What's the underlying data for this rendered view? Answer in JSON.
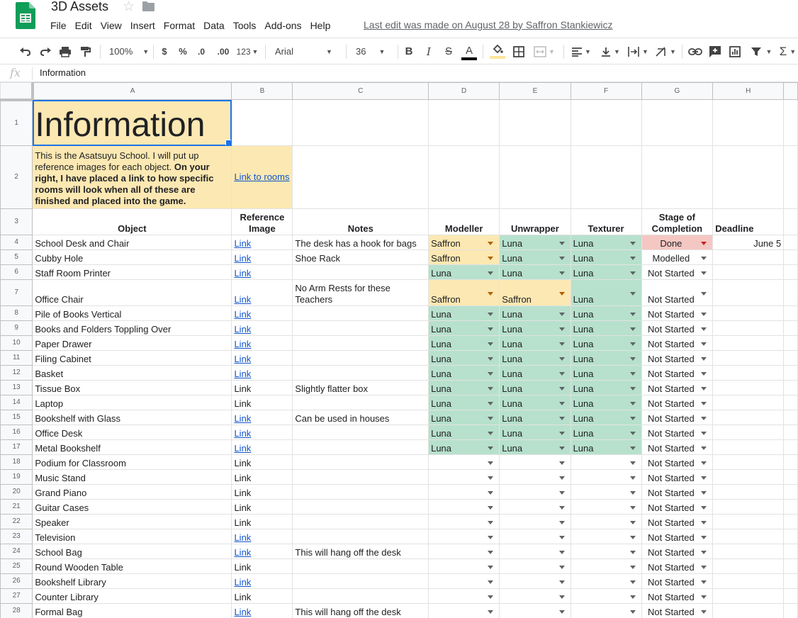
{
  "app": {
    "title": "3D Assets",
    "menus": [
      "File",
      "Edit",
      "View",
      "Insert",
      "Format",
      "Data",
      "Tools",
      "Add-ons",
      "Help"
    ],
    "last_edit": "Last edit was made on August 28 by Saffron Stankiewicz"
  },
  "toolbar": {
    "zoom": "100%",
    "currency": "$",
    "percent": "%",
    "decrease_decimals": ".0",
    "increase_decimals": ".00",
    "number_format": "123",
    "font": "Arial",
    "font_size": "36"
  },
  "formula_bar": {
    "fx": "fx",
    "value": "Information"
  },
  "columns": [
    "A",
    "B",
    "C",
    "D",
    "E",
    "F",
    "G",
    "H"
  ],
  "row1": {
    "title": "Information"
  },
  "row2": {
    "desc_normal": "This is the Asatsuyu School. I will put up reference images for each object. ",
    "desc_bold": "On your right, I have placed a link to how specific rooms will look when all of these are finished and placed into the game.",
    "rooms_link": "Link to rooms"
  },
  "headers": {
    "object": "Object",
    "reference": "Reference Image",
    "notes": "Notes",
    "modeller": "Modeller",
    "unwrapper": "Unwrapper",
    "texturer": "Texturer",
    "stage": "Stage of Completion",
    "deadline": "Deadline"
  },
  "rows": [
    {
      "n": "4",
      "object": "School Desk and Chair",
      "ref": "Link",
      "ref_link": true,
      "notes": "The desk has a hook for bags",
      "modeller": "Saffron",
      "unwrapper": "Luna",
      "texturer": "Luna",
      "stage": "Done",
      "deadline": "June 5"
    },
    {
      "n": "5",
      "object": "Cubby Hole",
      "ref": "Link",
      "ref_link": true,
      "notes": "Shoe Rack",
      "modeller": "Saffron",
      "unwrapper": "Luna",
      "texturer": "Luna",
      "stage": "Modelled",
      "deadline": ""
    },
    {
      "n": "6",
      "object": "Staff Room Printer",
      "ref": "Link",
      "ref_link": true,
      "notes": "",
      "modeller": "Luna",
      "unwrapper": "Luna",
      "texturer": "Luna",
      "stage": "Not Started",
      "deadline": ""
    },
    {
      "n": "7",
      "object": "Office Chair",
      "ref": "Link",
      "ref_link": true,
      "notes": "No Arm Rests for these Teachers",
      "modeller": "Saffron",
      "unwrapper": "Saffron",
      "texturer": "Luna",
      "stage": "Not Started",
      "deadline": ""
    },
    {
      "n": "8",
      "object": "Pile of Books Vertical",
      "ref": "Link",
      "ref_link": true,
      "notes": "",
      "modeller": "Luna",
      "unwrapper": "Luna",
      "texturer": "Luna",
      "stage": "Not Started",
      "deadline": ""
    },
    {
      "n": "9",
      "object": "Books and Folders Toppling Over",
      "ref": "Link",
      "ref_link": true,
      "notes": "",
      "modeller": "Luna",
      "unwrapper": "Luna",
      "texturer": "Luna",
      "stage": "Not Started",
      "deadline": ""
    },
    {
      "n": "10",
      "object": "Paper Drawer",
      "ref": "Link",
      "ref_link": true,
      "notes": "",
      "modeller": "Luna",
      "unwrapper": "Luna",
      "texturer": "Luna",
      "stage": "Not Started",
      "deadline": ""
    },
    {
      "n": "11",
      "object": "Filing Cabinet",
      "ref": "Link",
      "ref_link": true,
      "notes": "",
      "modeller": "Luna",
      "unwrapper": "Luna",
      "texturer": "Luna",
      "stage": "Not Started",
      "deadline": ""
    },
    {
      "n": "12",
      "object": "Basket",
      "ref": "Link",
      "ref_link": true,
      "notes": "",
      "modeller": "Luna",
      "unwrapper": "Luna",
      "texturer": "Luna",
      "stage": "Not Started",
      "deadline": ""
    },
    {
      "n": "13",
      "object": "Tissue Box",
      "ref": "Link",
      "ref_link": false,
      "notes": "Slightly flatter box",
      "modeller": "Luna",
      "unwrapper": "Luna",
      "texturer": "Luna",
      "stage": "Not Started",
      "deadline": ""
    },
    {
      "n": "14",
      "object": "Laptop",
      "ref": "Link",
      "ref_link": false,
      "notes": "",
      "modeller": "Luna",
      "unwrapper": "Luna",
      "texturer": "Luna",
      "stage": "Not Started",
      "deadline": ""
    },
    {
      "n": "15",
      "object": "Bookshelf with Glass",
      "ref": "Link",
      "ref_link": true,
      "notes": "Can be used in houses",
      "modeller": "Luna",
      "unwrapper": "Luna",
      "texturer": "Luna",
      "stage": "Not Started",
      "deadline": ""
    },
    {
      "n": "16",
      "object": "Office Desk",
      "ref": "Link",
      "ref_link": true,
      "notes": "",
      "modeller": "Luna",
      "unwrapper": "Luna",
      "texturer": "Luna",
      "stage": "Not Started",
      "deadline": ""
    },
    {
      "n": "17",
      "object": "Metal Bookshelf",
      "ref": "Link",
      "ref_link": true,
      "notes": "",
      "modeller": "Luna",
      "unwrapper": "Luna",
      "texturer": "Luna",
      "stage": "Not Started",
      "deadline": ""
    },
    {
      "n": "18",
      "object": "Podium for Classroom",
      "ref": "Link",
      "ref_link": false,
      "notes": "",
      "modeller": "",
      "unwrapper": "",
      "texturer": "",
      "stage": "Not Started",
      "deadline": ""
    },
    {
      "n": "19",
      "object": "Music Stand",
      "ref": "Link",
      "ref_link": false,
      "notes": "",
      "modeller": "",
      "unwrapper": "",
      "texturer": "",
      "stage": "Not Started",
      "deadline": ""
    },
    {
      "n": "20",
      "object": "Grand Piano",
      "ref": "Link",
      "ref_link": false,
      "notes": "",
      "modeller": "",
      "unwrapper": "",
      "texturer": "",
      "stage": "Not Started",
      "deadline": ""
    },
    {
      "n": "21",
      "object": "Guitar Cases",
      "ref": "Link",
      "ref_link": false,
      "notes": "",
      "modeller": "",
      "unwrapper": "",
      "texturer": "",
      "stage": "Not Started",
      "deadline": ""
    },
    {
      "n": "22",
      "object": "Speaker",
      "ref": "Link",
      "ref_link": false,
      "notes": "",
      "modeller": "",
      "unwrapper": "",
      "texturer": "",
      "stage": "Not Started",
      "deadline": ""
    },
    {
      "n": "23",
      "object": "Television",
      "ref": "Link",
      "ref_link": true,
      "notes": "",
      "modeller": "",
      "unwrapper": "",
      "texturer": "",
      "stage": "Not Started",
      "deadline": ""
    },
    {
      "n": "24",
      "object": "School Bag",
      "ref": "Link",
      "ref_link": true,
      "notes": "This will hang off the desk",
      "modeller": "",
      "unwrapper": "",
      "texturer": "",
      "stage": "Not Started",
      "deadline": ""
    },
    {
      "n": "25",
      "object": "Round Wooden Table",
      "ref": "Link",
      "ref_link": false,
      "notes": "",
      "modeller": "",
      "unwrapper": "",
      "texturer": "",
      "stage": "Not Started",
      "deadline": ""
    },
    {
      "n": "26",
      "object": "Bookshelf Library",
      "ref": "Link",
      "ref_link": true,
      "notes": "",
      "modeller": "",
      "unwrapper": "",
      "texturer": "",
      "stage": "Not Started",
      "deadline": ""
    },
    {
      "n": "27",
      "object": "Counter Library",
      "ref": "Link",
      "ref_link": false,
      "notes": "",
      "modeller": "",
      "unwrapper": "",
      "texturer": "",
      "stage": "Not Started",
      "deadline": ""
    },
    {
      "n": "28",
      "object": "Formal Bag",
      "ref": "Link",
      "ref_link": true,
      "notes": "This will hang off the desk",
      "modeller": "",
      "unwrapper": "",
      "texturer": "",
      "stage": "Not Started",
      "deadline": ""
    }
  ],
  "colors": {
    "saffron_fill": "#fce8b2",
    "luna_fill": "#b7e1cd",
    "done_fill": "#f4c7c3",
    "link": "#1155cc",
    "selection": "#1a73e8"
  },
  "icons": [
    "sheets-logo-icon",
    "star-icon",
    "folder-icon",
    "undo-icon",
    "redo-icon",
    "print-icon",
    "paint-format-icon",
    "bold-icon",
    "italic-icon",
    "strikethrough-icon",
    "text-color-icon",
    "fill-color-icon",
    "borders-icon",
    "merge-icon",
    "align-icon",
    "valign-icon",
    "wrap-icon",
    "rotate-icon",
    "link-icon",
    "comment-icon",
    "chart-icon",
    "filter-icon",
    "functions-icon"
  ]
}
